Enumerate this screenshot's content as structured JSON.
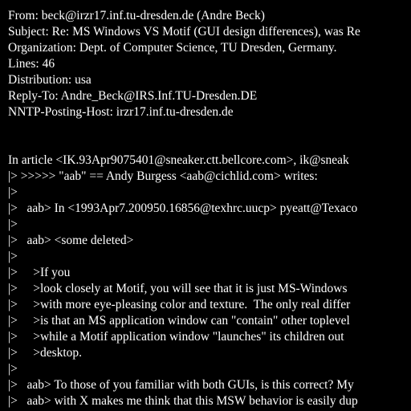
{
  "theme": {
    "background": "#000000",
    "text": "#ffffff"
  },
  "lines": [
    "From: beck@irzr17.inf.tu-dresden.de (Andre Beck)",
    "Subject: Re: MS Windows VS Motif (GUI design differences), was Re",
    "Organization: Dept. of Computer Science, TU Dresden, Germany.",
    "Lines: 46",
    "Distribution: usa",
    "Reply-To: Andre_Beck@IRS.Inf.TU-Dresden.DE",
    "NNTP-Posting-Host: irzr17.inf.tu-dresden.de",
    "",
    "",
    "In article <IK.93Apr9075401@sneaker.ctt.bellcore.com>, ik@sneak",
    "|> >>>>> \"aab\" == Andy Burgess <aab@cichlid.com> writes:",
    "|>",
    "|>   aab> In <1993Apr7.200950.16856@texhrc.uucp> pyeatt@Texaco",
    "|>",
    "|>   aab> <some deleted>",
    "|>",
    "|>     >If you",
    "|>     >look closely at Motif, you will see that it is just MS-Windows",
    "|>     >with more eye-pleasing color and texture.  The only real differ",
    "|>     >is that an MS application window can \"contain\" other toplevel",
    "|>     >while a Motif application window \"launches\" its children out",
    "|>     >desktop.",
    "|>",
    "|>   aab> To those of you familiar with both GUIs, is this correct? My",
    "|>   aab> with X makes me think that this MSW behavior is easily dup"
  ]
}
